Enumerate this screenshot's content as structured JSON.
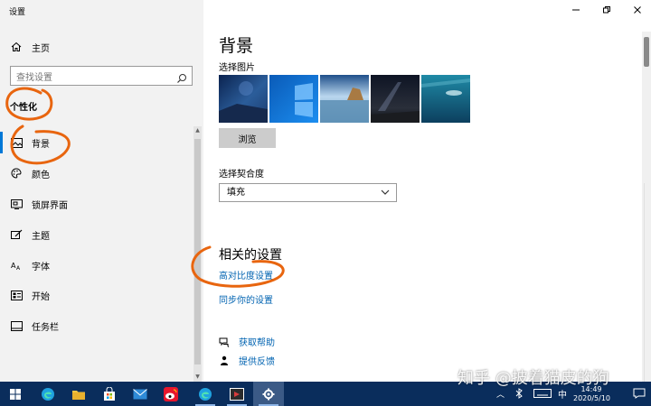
{
  "window": {
    "title": "设置"
  },
  "sidebar": {
    "home": "主页",
    "search_placeholder": "查找设置",
    "section": "个性化",
    "items": [
      {
        "label": "背景",
        "icon": "picture-icon",
        "active": true
      },
      {
        "label": "颜色",
        "icon": "palette-icon"
      },
      {
        "label": "锁屏界面",
        "icon": "lockscreen-icon"
      },
      {
        "label": "主题",
        "icon": "theme-icon"
      },
      {
        "label": "字体",
        "icon": "font-icon"
      },
      {
        "label": "开始",
        "icon": "start-icon"
      },
      {
        "label": "任务栏",
        "icon": "taskbar-icon"
      }
    ]
  },
  "main": {
    "title": "背景",
    "choose_picture": "选择图片",
    "browse": "浏览",
    "fit_label": "选择契合度",
    "fit_value": "填充",
    "related_title": "相关的设置",
    "links": [
      "高对比度设置",
      "同步你的设置"
    ],
    "help": "获取帮助",
    "feedback": "提供反馈"
  },
  "taskbar": {
    "ime": "中",
    "clock_time": "14:49",
    "clock_date": "2020/5/10"
  },
  "watermark": "知乎 @披着猫皮的狗",
  "colors": {
    "accent": "#0078d7",
    "link": "#0063b1",
    "taskbar": "#0a2d5c",
    "annotation": "#e8650f"
  }
}
